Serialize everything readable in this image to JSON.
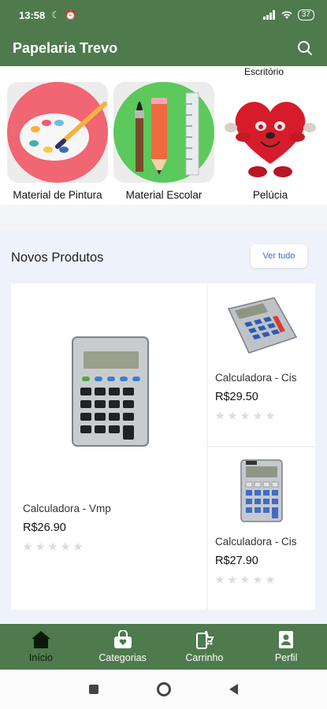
{
  "status_bar": {
    "time": "13:58",
    "battery": "37"
  },
  "app_bar": {
    "title": "Papelaria Trevo",
    "search_icon": "search-icon"
  },
  "categories": {
    "peek_label": "Escritório",
    "items": [
      {
        "label": "Material de Pintura",
        "icon": "paint-palette-icon"
      },
      {
        "label": "Material Escolar",
        "icon": "school-supplies-icon"
      },
      {
        "label": "Pelúcia",
        "icon": "plush-heart-icon"
      }
    ]
  },
  "novos": {
    "title": "Novos Produtos",
    "ver_tudo": "Ver tudo",
    "products": [
      {
        "name": "Calculadora - Vmp",
        "price": "R$26.90",
        "rating": 0
      },
      {
        "name": "Calculadora - Cis",
        "price": "R$29.50",
        "rating": 0
      },
      {
        "name": "Calculadora - Cis",
        "price": "R$27.90",
        "rating": 0
      }
    ]
  },
  "bottom_nav": [
    {
      "label": "Início",
      "icon": "home-icon",
      "active": true
    },
    {
      "label": "Categorias",
      "icon": "bag-icon",
      "active": false
    },
    {
      "label": "Carrinho",
      "icon": "cart-icon",
      "active": false
    },
    {
      "label": "Perfil",
      "icon": "profile-icon",
      "active": false
    }
  ],
  "colors": {
    "primary": "#4e7a4e",
    "link": "#3a6dd6"
  }
}
